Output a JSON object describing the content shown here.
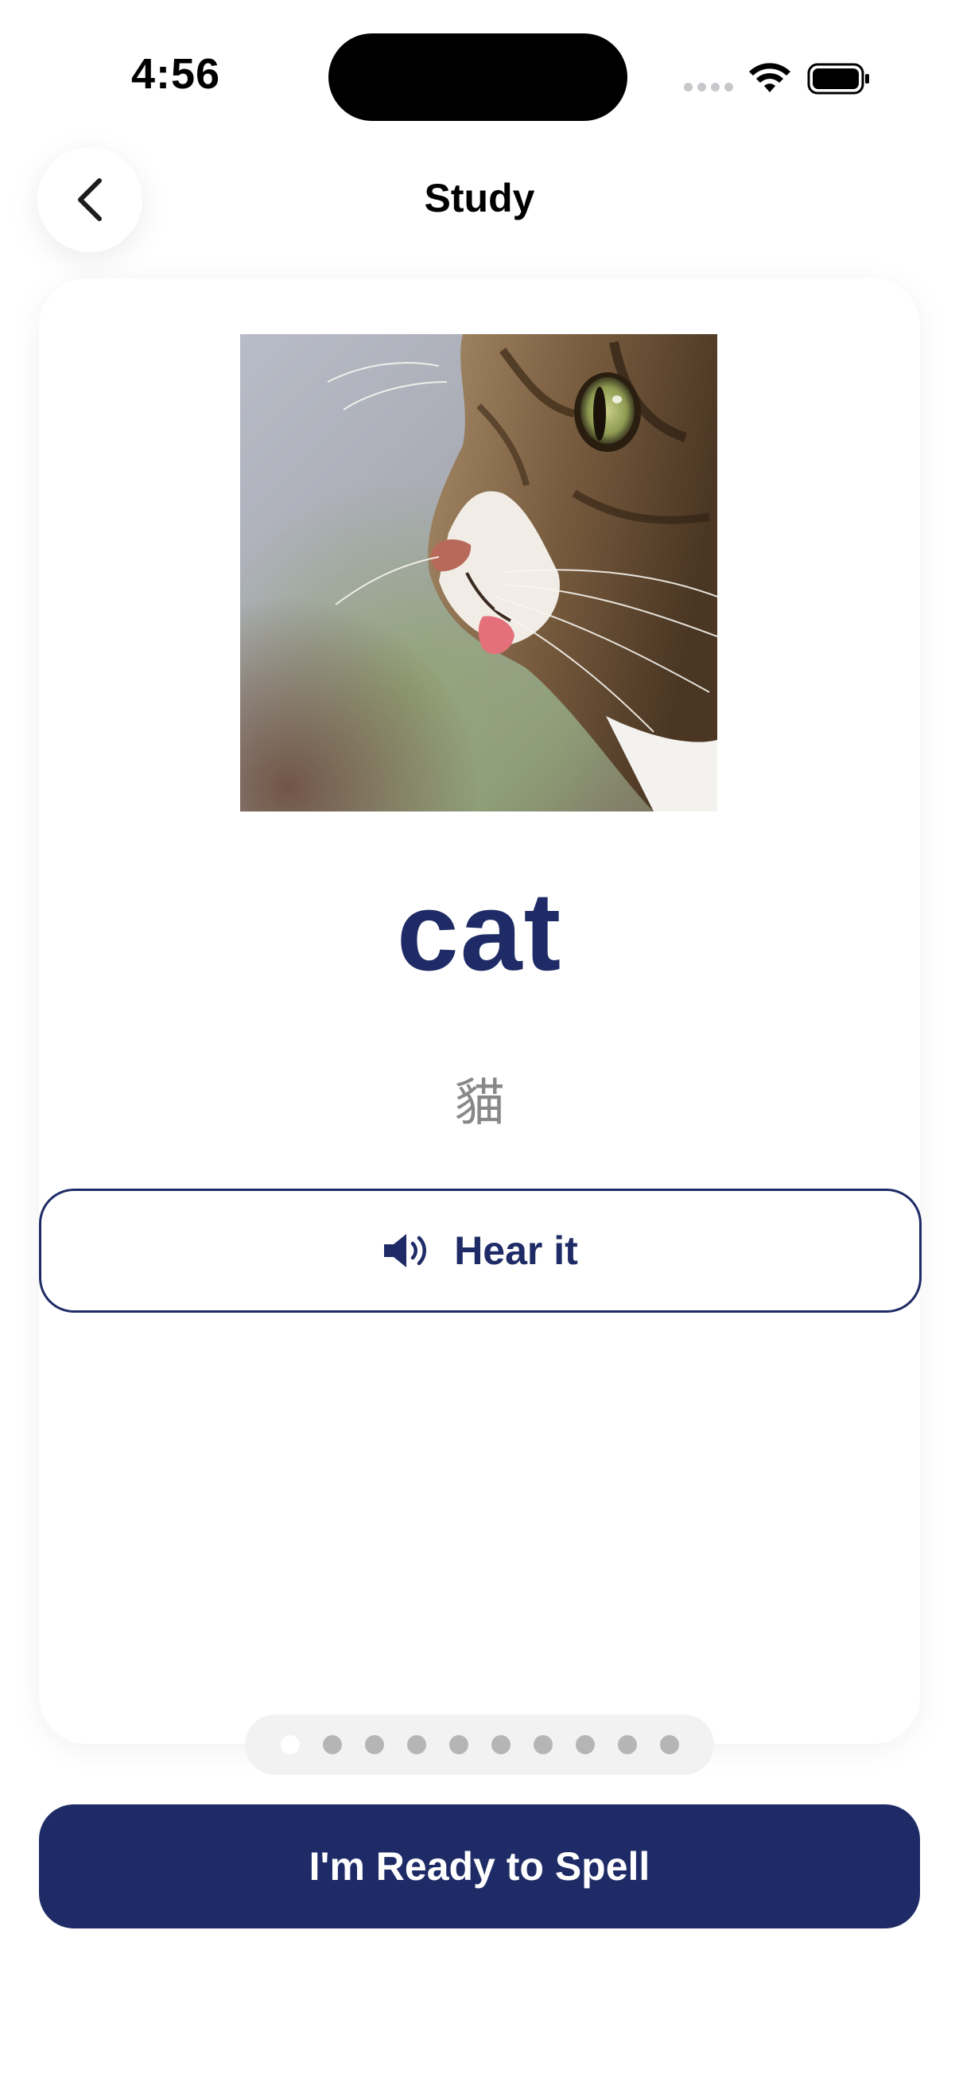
{
  "status_bar": {
    "time": "4:56"
  },
  "nav": {
    "title": "Study",
    "back_icon": "chevron-left-icon"
  },
  "card": {
    "image_subject": "cat",
    "word": "cat",
    "translation": "貓",
    "hear_button": {
      "label": "Hear it",
      "icon": "speaker-icon"
    }
  },
  "pager": {
    "total": 10,
    "current": 1
  },
  "primary_action": {
    "label": "I'm Ready to Spell"
  },
  "colors": {
    "accent": "#1f2b66",
    "translation_text": "#888888",
    "pager_dot": "#b5b5b5",
    "pager_bg": "#f2f2f2"
  }
}
